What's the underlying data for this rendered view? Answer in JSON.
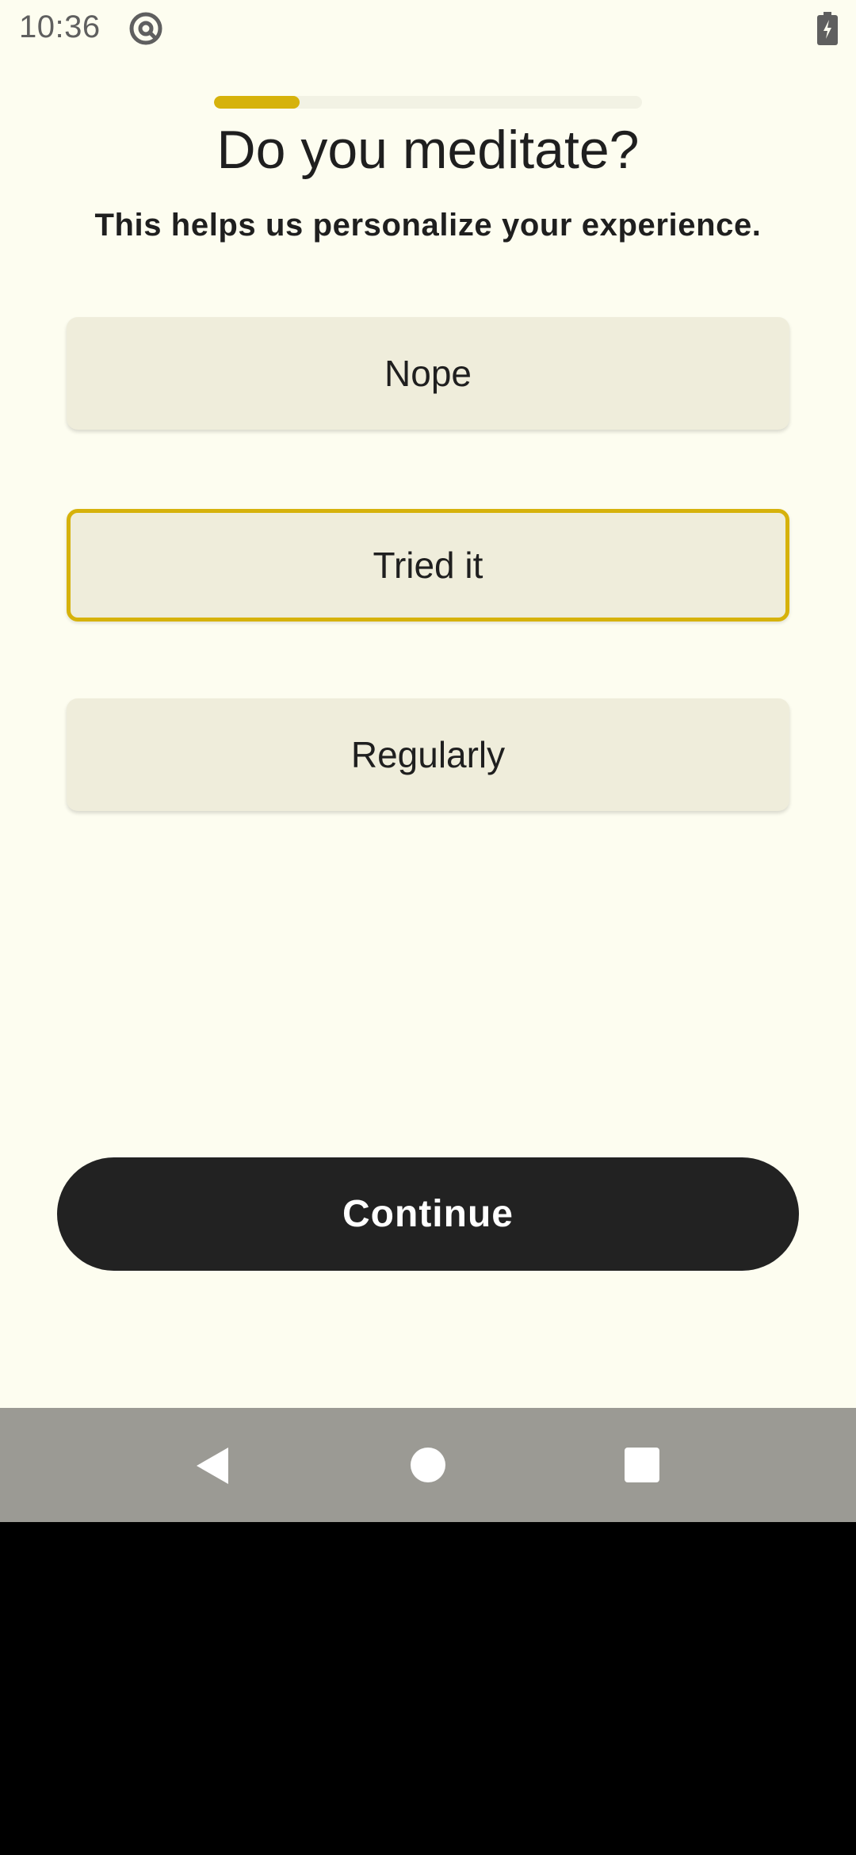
{
  "status_bar": {
    "time": "10:36",
    "app_icon": "at-sign-notification-icon",
    "battery_icon": "battery-charging-icon"
  },
  "progress": {
    "value": 0.2
  },
  "question": {
    "title": "Do you meditate?",
    "subtitle": "This helps us personalize your experience."
  },
  "options": [
    {
      "label": "Nope",
      "selected": false
    },
    {
      "label": "Tried it",
      "selected": true
    },
    {
      "label": "Regularly",
      "selected": false
    }
  ],
  "continue_label": "Continue",
  "nav_bar": {
    "back_icon": "back-triangle-icon",
    "home_icon": "home-circle-icon",
    "recents_icon": "recents-square-icon"
  },
  "colors": {
    "background": "#fdfdf0",
    "accent": "#d6b20b",
    "option_bg": "#efeddb",
    "button_bg": "#222222",
    "text": "#1f1f1f"
  }
}
